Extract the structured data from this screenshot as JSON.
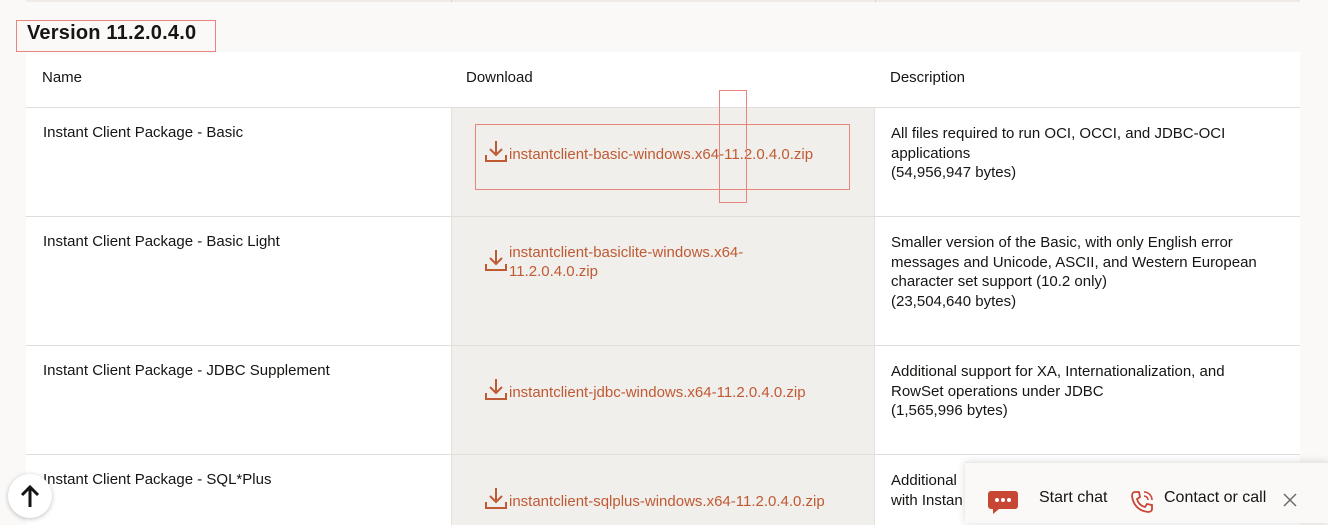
{
  "version_title": "Version 11.2.0.4.0",
  "table": {
    "headers": {
      "name": "Name",
      "download": "Download",
      "description": "Description"
    },
    "rows": [
      {
        "name": "Instant Client Package - Basic",
        "link": "instantclient-basic-windows.x64-11.2.0.4.0.zip",
        "desc_lines": [
          "All files required to run OCI, OCCI, and JDBC-OCI",
          "applications",
          "(54,956,947 bytes)"
        ]
      },
      {
        "name": "Instant Client Package - Basic Light",
        "link_lines": [
          "instantclient-basiclite-windows.x64-",
          "11.2.0.4.0.zip"
        ],
        "desc_lines": [
          "Smaller version of the Basic, with only English error",
          "messages and Unicode, ASCII, and Western European",
          "character set support (10.2 only)",
          "(23,504,640 bytes)"
        ]
      },
      {
        "name": "Instant Client Package - JDBC Supplement",
        "link": "instantclient-jdbc-windows.x64-11.2.0.4.0.zip",
        "desc_lines": [
          "Additional support for XA, Internationalization, and",
          "RowSet operations under JDBC",
          "(1,565,996 bytes)"
        ]
      },
      {
        "name": "Instant Client Package - SQL*Plus",
        "link": "instantclient-sqlplus-windows.x64-11.2.0.4.0.zip",
        "desc_lines": [
          "Additional",
          "with Instan"
        ]
      }
    ]
  },
  "chat": {
    "start_chat": "Start chat",
    "contact": "Contact or call"
  },
  "colors": {
    "link": "#c05a34",
    "highlight": "#e8857c",
    "chat_icon": "#c74634"
  }
}
